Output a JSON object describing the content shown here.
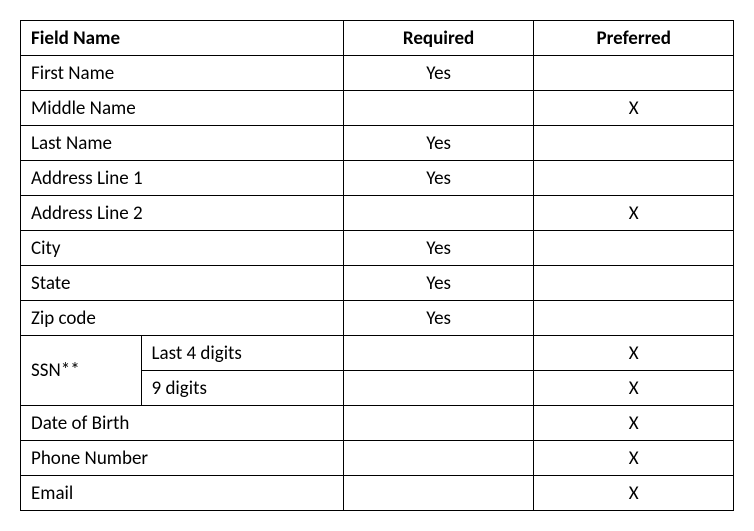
{
  "headers": {
    "field_name": "Field Name",
    "required": "Required",
    "preferred": "Preferred"
  },
  "rows": {
    "first_name": {
      "label": "First Name",
      "required": "Yes",
      "preferred": ""
    },
    "middle_name": {
      "label": "Middle Name",
      "required": "",
      "preferred": "X"
    },
    "last_name": {
      "label": "Last Name",
      "required": "Yes",
      "preferred": ""
    },
    "address1": {
      "label": "Address Line 1",
      "required": "Yes",
      "preferred": ""
    },
    "address2": {
      "label": "Address Line 2",
      "required": "",
      "preferred": "X"
    },
    "city": {
      "label": "City",
      "required": "Yes",
      "preferred": ""
    },
    "state": {
      "label": "State",
      "required": "Yes",
      "preferred": ""
    },
    "zip": {
      "label": "Zip code",
      "required": "Yes",
      "preferred": ""
    },
    "ssn_group": {
      "label": "SSN**"
    },
    "ssn_last4": {
      "label": "Last 4 digits",
      "required": "",
      "preferred": "X"
    },
    "ssn_9": {
      "label": "9 digits",
      "required": "",
      "preferred": "X"
    },
    "dob": {
      "label": "Date of Birth",
      "required": "",
      "preferred": "X"
    },
    "phone": {
      "label": "Phone Number",
      "required": "",
      "preferred": "X"
    },
    "email": {
      "label": "Email",
      "required": "",
      "preferred": "X"
    }
  }
}
